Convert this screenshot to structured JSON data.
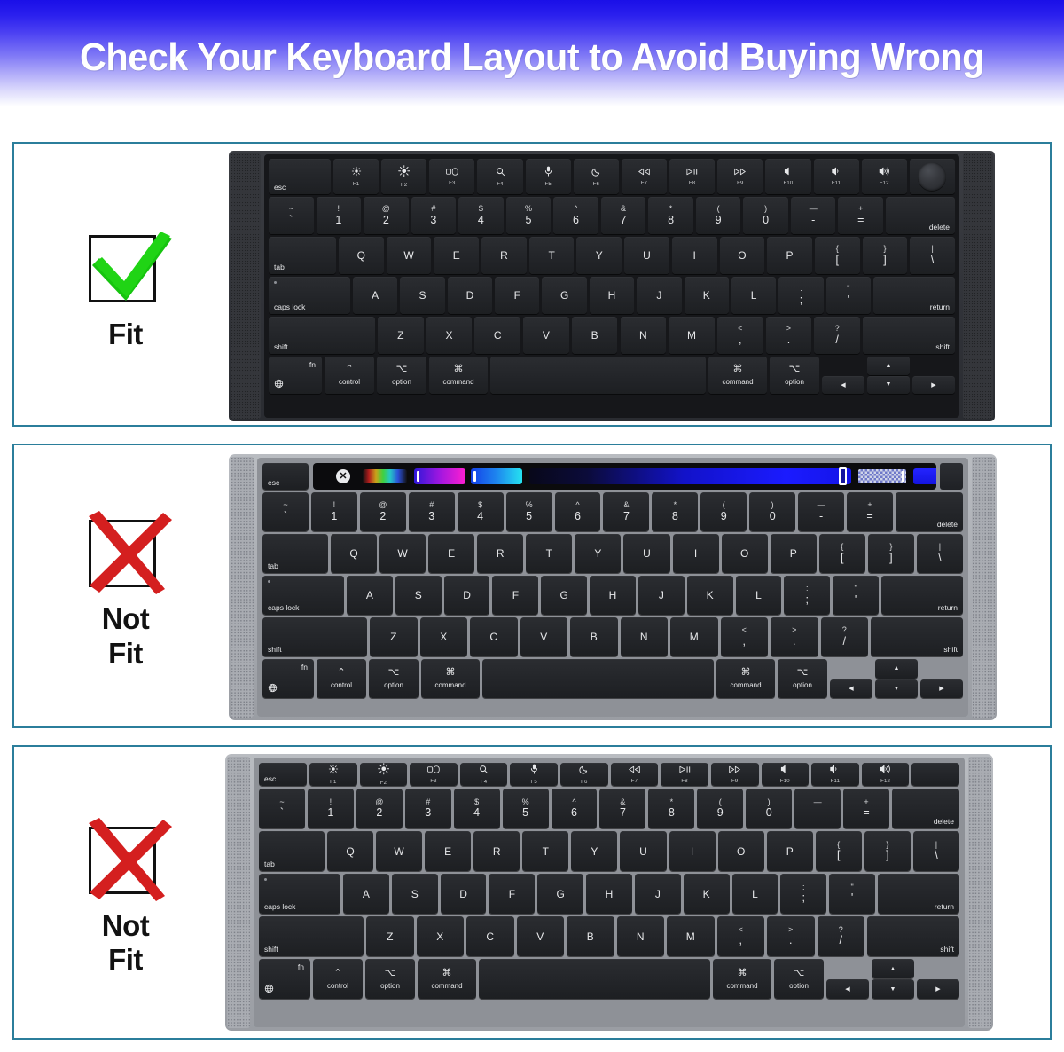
{
  "header": {
    "title": "Check Your Keyboard Layout to Avoid Buying Wrong",
    "gradient_top": "#1a0fe8",
    "gradient_bottom": "#ffffff",
    "text_color": "#ffffff"
  },
  "panel_border_color": "#2b7e9b",
  "verdicts": [
    {
      "id": "fit",
      "icon": "green-check-icon",
      "label": "Fit",
      "label_line2": "",
      "color": "#16c40f"
    },
    {
      "id": "not-fit-1",
      "icon": "red-x-icon",
      "label": "Not",
      "label_line2": "Fit",
      "color": "#d41f1f"
    },
    {
      "id": "not-fit-2",
      "icon": "red-x-icon",
      "label": "Not",
      "label_line2": "Fit",
      "color": "#d41f1f"
    }
  ],
  "keyboards": [
    {
      "id": "keyboard-dark-touchid",
      "style": "space-gray",
      "has_touch_bar": false,
      "has_touch_id": true,
      "has_function_row": true,
      "function_row": [
        {
          "key": "esc",
          "label": "esc",
          "icon": ""
        },
        {
          "key": "F1",
          "label": "F1",
          "icon": "brightness-low-icon"
        },
        {
          "key": "F2",
          "label": "F2",
          "icon": "brightness-high-icon"
        },
        {
          "key": "F3",
          "label": "F3",
          "icon": "mission-control-icon"
        },
        {
          "key": "F4",
          "label": "F4",
          "icon": "spotlight-search-icon"
        },
        {
          "key": "F5",
          "label": "F5",
          "icon": "dictation-mic-icon"
        },
        {
          "key": "F6",
          "label": "F6",
          "icon": "do-not-disturb-moon-icon"
        },
        {
          "key": "F7",
          "label": "F7",
          "icon": "rewind-icon"
        },
        {
          "key": "F8",
          "label": "F8",
          "icon": "play-pause-icon"
        },
        {
          "key": "F9",
          "label": "F9",
          "icon": "fast-forward-icon"
        },
        {
          "key": "F10",
          "label": "F10",
          "icon": "mute-icon"
        },
        {
          "key": "F11",
          "label": "F11",
          "icon": "volume-down-icon"
        },
        {
          "key": "F12",
          "label": "F12",
          "icon": "volume-up-icon"
        },
        {
          "key": "touchid",
          "label": "",
          "icon": "touch-id-icon"
        }
      ]
    },
    {
      "id": "keyboard-silver-touchbar",
      "style": "silver",
      "has_touch_bar": true,
      "has_touch_id": false,
      "has_function_row": false,
      "touch_bar": {
        "esc_label": "esc",
        "close_glyph": "✕",
        "items": [
          {
            "name": "close-button",
            "type": "round-button"
          },
          {
            "name": "rainbow-slider",
            "type": "gradient-chip",
            "colors": "rainbow"
          },
          {
            "name": "violet-magenta-chip",
            "type": "gradient-chip",
            "colors": "#2e17d8 → #ff1fd0"
          },
          {
            "name": "blue-cyan-chip",
            "type": "gradient-chip",
            "colors": "#1440e8 → #25e3f0"
          },
          {
            "name": "deep-blue-bar",
            "type": "gradient-bar",
            "colors": "#08081a → #1b1bff"
          },
          {
            "name": "position-cursor",
            "type": "cursor"
          },
          {
            "name": "opacity-checker",
            "type": "checkerboard-slider"
          },
          {
            "name": "blue-swatch",
            "type": "solid-swatch",
            "colors": "#2424ff"
          }
        ]
      }
    },
    {
      "id": "keyboard-silver-fnrow",
      "style": "silver",
      "has_touch_bar": false,
      "has_touch_id": false,
      "has_function_row": true,
      "function_row": [
        {
          "key": "esc",
          "label": "esc",
          "icon": ""
        },
        {
          "key": "F1",
          "label": "F1",
          "icon": "brightness-low-icon"
        },
        {
          "key": "F2",
          "label": "F2",
          "icon": "brightness-high-icon"
        },
        {
          "key": "F3",
          "label": "F3",
          "icon": "mission-control-icon"
        },
        {
          "key": "F4",
          "label": "F4",
          "icon": "spotlight-search-icon"
        },
        {
          "key": "F5",
          "label": "F5",
          "icon": "dictation-mic-icon"
        },
        {
          "key": "F6",
          "label": "F6",
          "icon": "do-not-disturb-moon-icon"
        },
        {
          "key": "F7",
          "label": "F7",
          "icon": "rewind-icon"
        },
        {
          "key": "F8",
          "label": "F8",
          "icon": "play-pause-icon"
        },
        {
          "key": "F9",
          "label": "F9",
          "icon": "fast-forward-icon"
        },
        {
          "key": "F10",
          "label": "F10",
          "icon": "mute-icon"
        },
        {
          "key": "F11",
          "label": "F11",
          "icon": "volume-down-icon"
        },
        {
          "key": "F12",
          "label": "F12",
          "icon": "volume-up-icon"
        },
        {
          "key": "blank",
          "label": "",
          "icon": ""
        }
      ]
    }
  ],
  "key_rows": {
    "number_row": [
      {
        "top": "~",
        "bot": "`"
      },
      {
        "top": "!",
        "bot": "1"
      },
      {
        "top": "@",
        "bot": "2"
      },
      {
        "top": "#",
        "bot": "3"
      },
      {
        "top": "$",
        "bot": "4"
      },
      {
        "top": "%",
        "bot": "5"
      },
      {
        "top": "^",
        "bot": "6"
      },
      {
        "top": "&",
        "bot": "7"
      },
      {
        "top": "*",
        "bot": "8"
      },
      {
        "top": "(",
        "bot": "9"
      },
      {
        "top": ")",
        "bot": "0"
      },
      {
        "top": "—",
        "bot": "-"
      },
      {
        "top": "+",
        "bot": "="
      }
    ],
    "number_row_end": "delete",
    "top_row": [
      "Q",
      "W",
      "E",
      "R",
      "T",
      "Y",
      "U",
      "I",
      "O",
      "P"
    ],
    "top_row_start": "tab",
    "top_row_brackets": [
      {
        "top": "{",
        "bot": "["
      },
      {
        "top": "}",
        "bot": "]"
      },
      {
        "top": "|",
        "bot": "\\"
      }
    ],
    "home_row": [
      "A",
      "S",
      "D",
      "F",
      "G",
      "H",
      "J",
      "K",
      "L"
    ],
    "home_row_start": "caps lock",
    "home_row_punct": [
      {
        "top": ":",
        "bot": ";"
      },
      {
        "top": "\"",
        "bot": "'"
      }
    ],
    "home_row_end": "return",
    "bottom_row": [
      "Z",
      "X",
      "C",
      "V",
      "B",
      "N",
      "M"
    ],
    "bottom_row_start": "shift",
    "bottom_row_punct": [
      {
        "top": "<",
        "bot": ","
      },
      {
        "top": ">",
        "bot": "."
      },
      {
        "top": "?",
        "bot": "/"
      }
    ],
    "bottom_row_end": "shift",
    "modifier_row": {
      "fn": "fn",
      "globe_icon": "globe-icon",
      "control": {
        "glyph": "⌃",
        "word": "control"
      },
      "option_left": {
        "glyph": "⌥",
        "word": "option"
      },
      "command_left": {
        "glyph": "⌘",
        "word": "command"
      },
      "space": "",
      "command_right": {
        "glyph": "⌘",
        "word": "command"
      },
      "option_right": {
        "glyph": "⌥",
        "word": "option"
      },
      "arrows": {
        "up": "▲",
        "left": "◀",
        "down": "▼",
        "right": "▶"
      }
    }
  }
}
